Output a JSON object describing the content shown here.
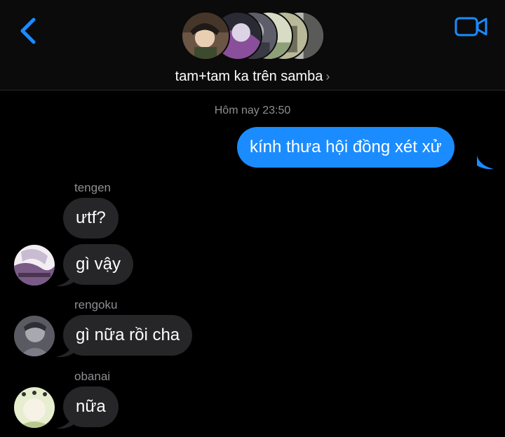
{
  "header": {
    "back_icon": "chevron-left-icon",
    "video_icon": "video-camera-icon",
    "group_name": "tam+tam ka trên samba",
    "group_chevron": "›",
    "accent_color": "#1a8cff"
  },
  "conversation": {
    "timestamp": "Hôm nay 23:50",
    "outgoing": [
      {
        "text": "kính thưa hội đồng xét xử"
      }
    ],
    "incoming_groups": [
      {
        "sender": "tengen",
        "messages": [
          "ưtf?",
          "gì vậy"
        ]
      },
      {
        "sender": "rengoku",
        "messages": [
          "gì nữa rồi cha"
        ]
      },
      {
        "sender": "obanai",
        "messages": [
          "nữa"
        ]
      }
    ]
  },
  "colors": {
    "background": "#000000",
    "outgoing_bubble": "#1a8cff",
    "incoming_bubble": "#262628",
    "secondary_text": "#8e8e93"
  }
}
